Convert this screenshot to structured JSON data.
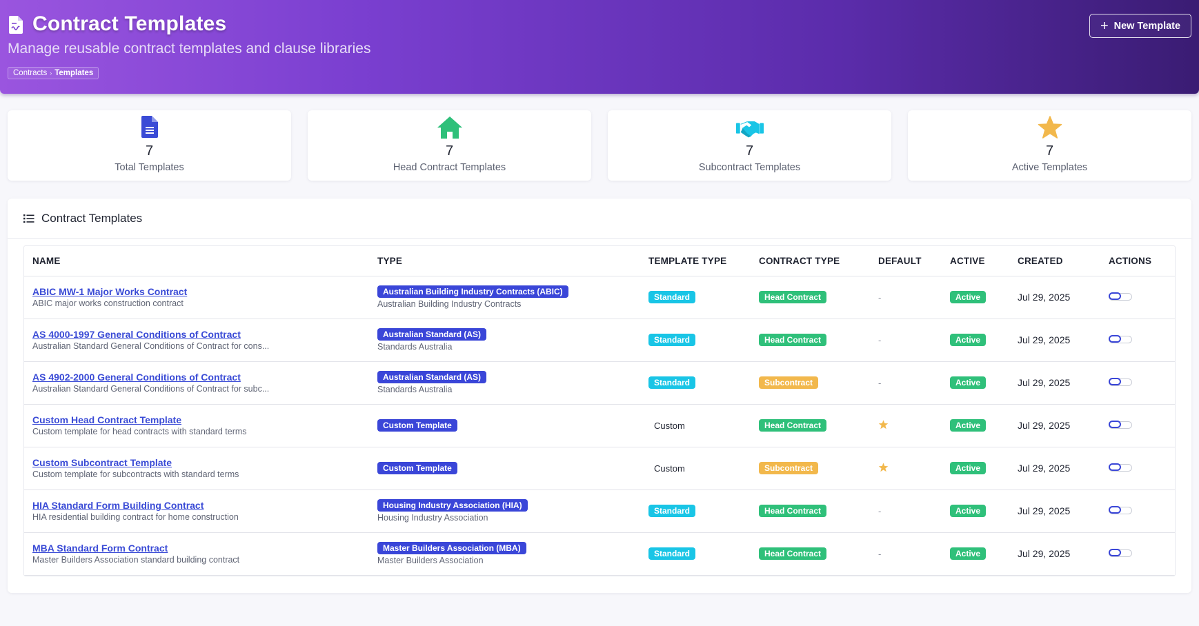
{
  "header": {
    "title": "Contract Templates",
    "subtitle": "Manage reusable contract templates and clause libraries",
    "breadcrumb": [
      "Contracts",
      "Templates"
    ],
    "new_button_label": "New Template"
  },
  "stats": [
    {
      "value": "7",
      "label": "Total Templates",
      "icon": "document-icon",
      "color": "#3a4bd6"
    },
    {
      "value": "7",
      "label": "Head Contract Templates",
      "icon": "home-icon",
      "color": "#2fc07a"
    },
    {
      "value": "7",
      "label": "Subcontract Templates",
      "icon": "handshake-icon",
      "color": "#19c5e6"
    },
    {
      "value": "7",
      "label": "Active Templates",
      "icon": "star-icon",
      "color": "#f2b84c"
    }
  ],
  "table": {
    "section_title": "Contract Templates",
    "columns": [
      "NAME",
      "TYPE",
      "TEMPLATE TYPE",
      "CONTRACT TYPE",
      "DEFAULT",
      "ACTIVE",
      "CREATED",
      "ACTIONS"
    ],
    "rows": [
      {
        "name": "ABIC MW-1 Major Works Contract",
        "desc": "ABIC major works construction contract",
        "type": "Australian Building Industry Contracts (ABIC)",
        "type_desc": "Australian Building Industry Contracts",
        "template_type": "Standard",
        "contract_type": "Head Contract",
        "default": "-",
        "active": "Active",
        "created": "Jul 29, 2025"
      },
      {
        "name": "AS 4000-1997 General Conditions of Contract",
        "desc": "Australian Standard General Conditions of Contract for cons...",
        "type": "Australian Standard (AS)",
        "type_desc": "Standards Australia",
        "template_type": "Standard",
        "contract_type": "Head Contract",
        "default": "-",
        "active": "Active",
        "created": "Jul 29, 2025"
      },
      {
        "name": "AS 4902-2000 General Conditions of Contract",
        "desc": "Australian Standard General Conditions of Contract for subc...",
        "type": "Australian Standard (AS)",
        "type_desc": "Standards Australia",
        "template_type": "Standard",
        "contract_type": "Subcontract",
        "default": "-",
        "active": "Active",
        "created": "Jul 29, 2025"
      },
      {
        "name": "Custom Head Contract Template",
        "desc": "Custom template for head contracts with standard terms",
        "type": "Custom Template",
        "type_desc": "",
        "template_type": "Custom",
        "contract_type": "Head Contract",
        "default": "star",
        "active": "Active",
        "created": "Jul 29, 2025"
      },
      {
        "name": "Custom Subcontract Template",
        "desc": "Custom template for subcontracts with standard terms",
        "type": "Custom Template",
        "type_desc": "",
        "template_type": "Custom",
        "contract_type": "Subcontract",
        "default": "star",
        "active": "Active",
        "created": "Jul 29, 2025"
      },
      {
        "name": "HIA Standard Form Building Contract",
        "desc": "HIA residential building contract for home construction",
        "type": "Housing Industry Association (HIA)",
        "type_desc": "Housing Industry Association",
        "template_type": "Standard",
        "contract_type": "Head Contract",
        "default": "-",
        "active": "Active",
        "created": "Jul 29, 2025"
      },
      {
        "name": "MBA Standard Form Contract",
        "desc": "Master Builders Association standard building contract",
        "type": "Master Builders Association (MBA)",
        "type_desc": "Master Builders Association",
        "template_type": "Standard",
        "contract_type": "Head Contract",
        "default": "-",
        "active": "Active",
        "created": "Jul 29, 2025"
      }
    ]
  }
}
